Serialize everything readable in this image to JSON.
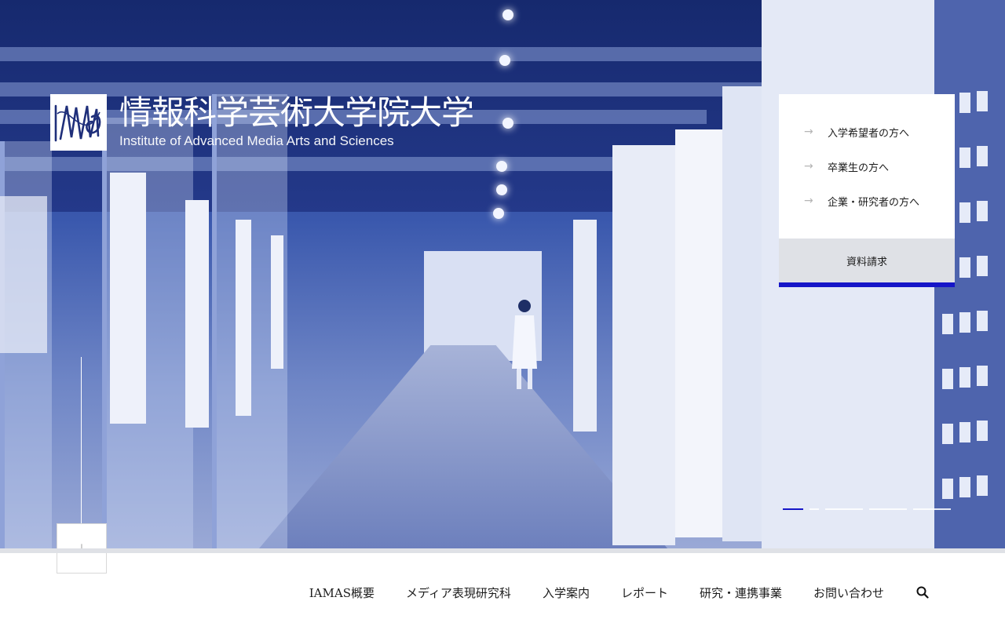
{
  "brand": {
    "name_jp": "情報科学芸術大学院大学",
    "name_en": "Institute of Advanced Media Arts and Sciences",
    "logo_icon": "iamas-logo-icon"
  },
  "panel": {
    "links": [
      {
        "label": "入学希望者の方へ",
        "icon": "arrow-right-icon"
      },
      {
        "label": "卒業生の方へ",
        "icon": "arrow-right-icon"
      },
      {
        "label": "企業・研究者の方へ",
        "icon": "arrow-right-icon"
      }
    ],
    "request_label": "資料請求"
  },
  "slider": {
    "count": 5,
    "active_index": 0
  },
  "scroll_icon": "arrow-down-icon",
  "nav": {
    "items": [
      "IAMAS概要",
      "メディア表現研究科",
      "入学案内",
      "レポート",
      "研究・連携事業",
      "お問い合わせ"
    ],
    "search_icon": "search-icon"
  },
  "colors": {
    "accent": "#1616c8",
    "hero_tint": "#2f4aa0",
    "panel_bg": "#ffffff",
    "request_bg": "#dfe1e6"
  }
}
